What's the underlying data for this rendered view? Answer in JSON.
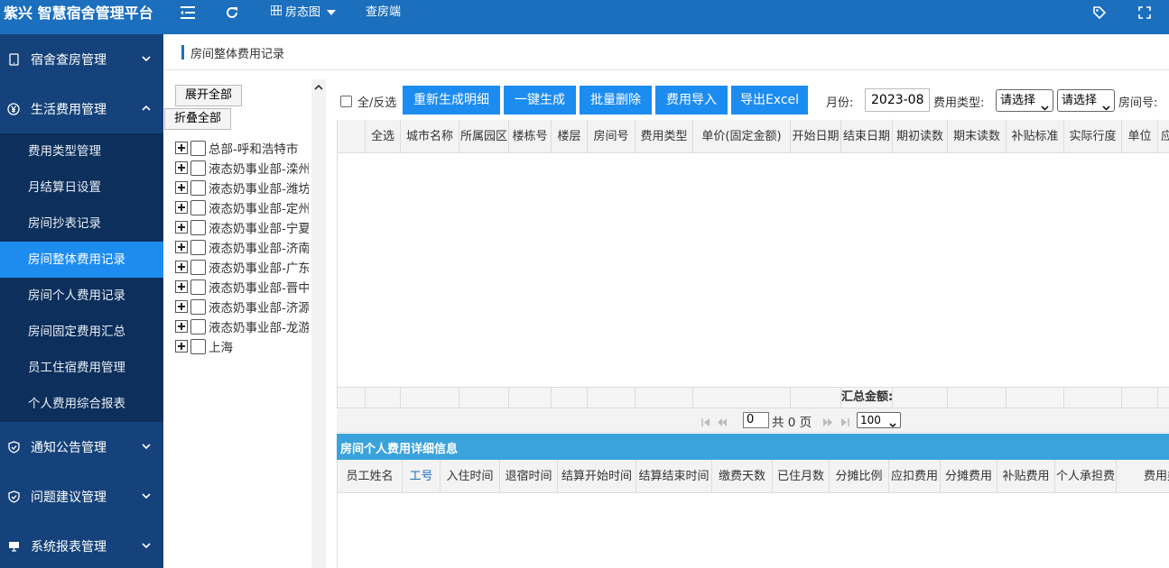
{
  "header": {
    "brand": "紫兴 智慧宿舍管理平台",
    "nav_room_map": "房态图",
    "nav_inspect": "查房端"
  },
  "sidebar": {
    "groups": [
      {
        "label": "宿舍查房管理"
      },
      {
        "label": "生活费用管理"
      },
      {
        "label": "通知公告管理"
      },
      {
        "label": "问题建议管理"
      },
      {
        "label": "系统报表管理"
      }
    ],
    "sub_items": [
      {
        "label": "费用类型管理"
      },
      {
        "label": "月结算日设置"
      },
      {
        "label": "房间抄表记录"
      },
      {
        "label": "房间整体费用记录"
      },
      {
        "label": "房间个人费用记录"
      },
      {
        "label": "房间固定费用汇总"
      },
      {
        "label": "员工住宿费用管理"
      },
      {
        "label": "个人费用综合报表"
      }
    ]
  },
  "page": {
    "title": "房间整体费用记录"
  },
  "tree": {
    "expand_all": "展开全部",
    "collapse_all": "折叠全部",
    "nodes": [
      {
        "label": "总部-呼和浩特市"
      },
      {
        "label": "液态奶事业部-滦州"
      },
      {
        "label": "液态奶事业部-潍坊"
      },
      {
        "label": "液态奶事业部-定州"
      },
      {
        "label": "液态奶事业部-宁夏"
      },
      {
        "label": "液态奶事业部-济南"
      },
      {
        "label": "液态奶事业部-广东"
      },
      {
        "label": "液态奶事业部-晋中"
      },
      {
        "label": "液态奶事业部-济源"
      },
      {
        "label": "液态奶事业部-龙游"
      },
      {
        "label": "上海"
      }
    ]
  },
  "toolbar": {
    "select_all": "全/反选",
    "btn_regenerate": "重新生成明细",
    "btn_generate": "一键生成",
    "btn_batch_delete": "批量删除",
    "btn_import": "费用导入",
    "btn_export": "导出Excel",
    "month_label": "月份:",
    "month_value": "2023-08",
    "fee_type_label": "费用类型:",
    "fee_type_value": "请选择",
    "second_select_value": "请选择",
    "room_no_label": "房间号:"
  },
  "grid": {
    "columns": [
      "全选",
      "城市名称",
      "所属园区",
      "楼栋号",
      "楼层",
      "房间号",
      "费用类型",
      "单价(固定金额)",
      "开始日期",
      "结束日期",
      "期初读数",
      "期末读数",
      "补贴标准",
      "实际行度",
      "单位",
      "应"
    ],
    "footer_total_label": "汇总金额:"
  },
  "pager": {
    "page_value": "0",
    "total_text": "共 0 页",
    "page_size": "100"
  },
  "detail": {
    "title": "房间个人费用详细信息",
    "columns": [
      "员工姓名",
      "工号",
      "入住时间",
      "退宿时间",
      "结算开始时间",
      "结算结束时间",
      "缴费天数",
      "已住月数",
      "分摊比例",
      "应扣费用",
      "分摊费用",
      "补贴费用",
      "个人承担费",
      "费用类"
    ]
  }
}
